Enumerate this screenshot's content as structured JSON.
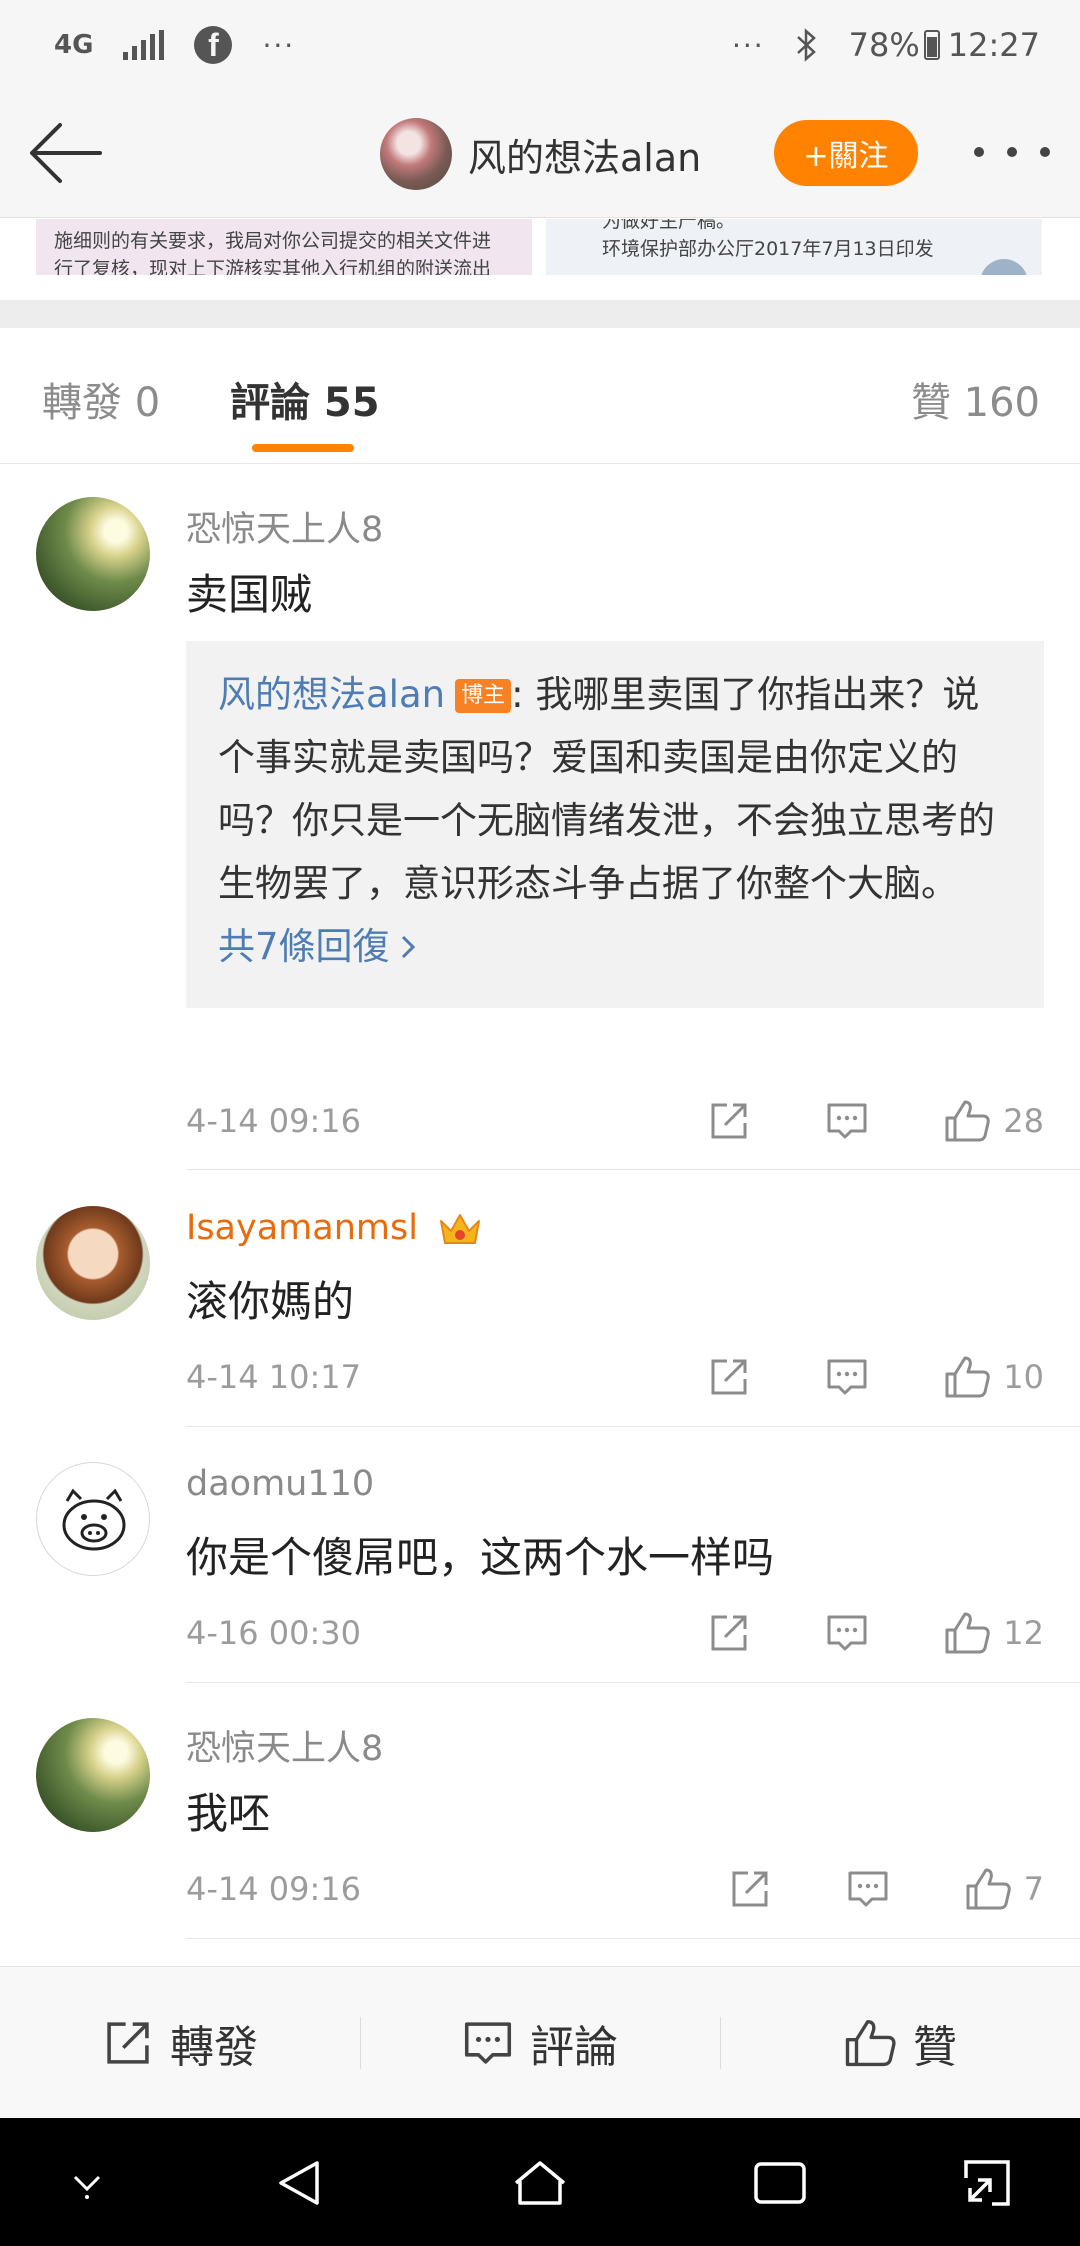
{
  "status_bar": {
    "network": "4G",
    "more_dots": "···",
    "right_dots": "···",
    "battery": "78%",
    "time": "12:27"
  },
  "header": {
    "title": "风的想法alan",
    "follow_label": "+關注"
  },
  "strip": {
    "left_line1": "施细则的有关要求，我局对你公司提交的相关文件进",
    "left_line2": "行了复核，现对上下游核实其他入行机组的附送流出",
    "right_line1": "为做好生产稿。",
    "right_line2": "环境保护部办公厅2017年7月13日印发"
  },
  "tabs": {
    "repost": "轉發 0",
    "comment": "評論 55",
    "like": "贊 160"
  },
  "comments": [
    {
      "name": "恐惊天上人8",
      "text": "卖国贼",
      "reply": {
        "author": "风的想法alan",
        "badge": "博主",
        "text": ": 我哪里卖国了你指出来？说个事实就是卖国吗？爱国和卖国是由你定义的吗？你只是一个无脑情绪发泄，不会独立思考的生物罢了，意识形态斗争占据了你整个大脑。",
        "more": "共7條回復"
      },
      "time": "4-14 09:16",
      "likes": "28"
    },
    {
      "name": "Isayamanmsl",
      "text": "滚你媽的",
      "time": "4-14 10:17",
      "likes": "10"
    },
    {
      "name": "daomu110",
      "text": "你是个傻屌吧，这两个水一样吗",
      "time": "4-16 00:30",
      "likes": "12"
    },
    {
      "name": "恐惊天上人8",
      "text": "我呸",
      "time": "4-14 09:16",
      "likes": "7"
    }
  ],
  "bottom_bar": {
    "repost": "轉發",
    "comment": "評論",
    "like": "贊"
  },
  "colors": {
    "accent": "#ff8200",
    "link": "#4f7db3",
    "vip_name": "#e86b0c"
  }
}
